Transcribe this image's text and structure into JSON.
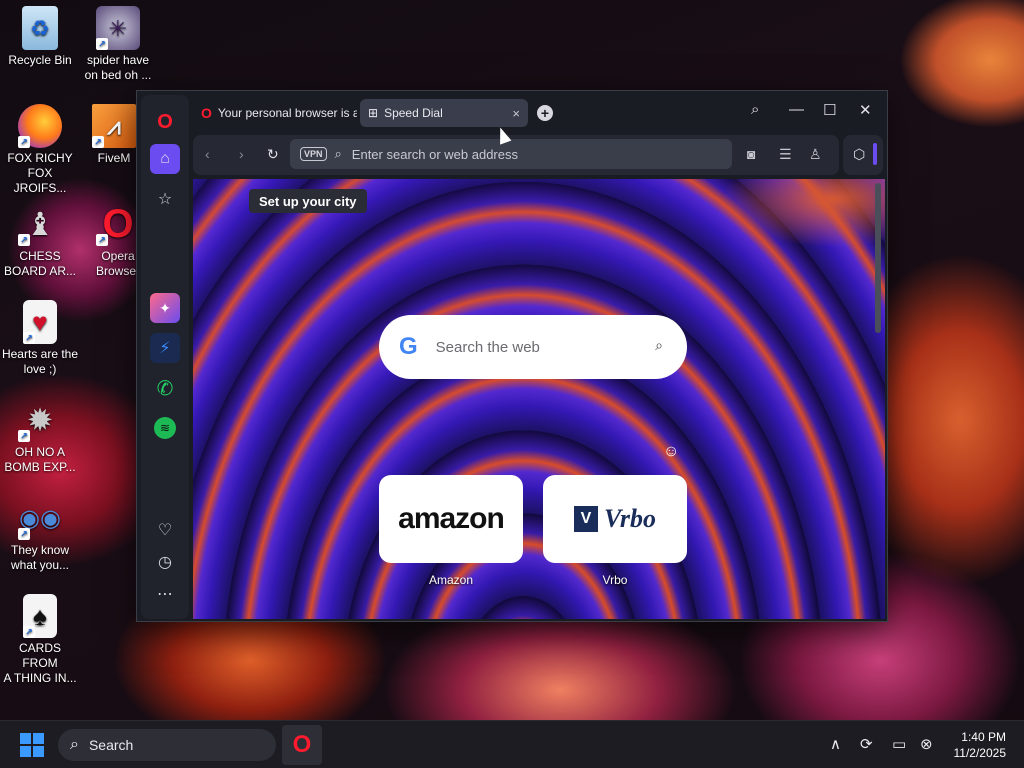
{
  "desktop": {
    "icons": [
      {
        "label_1": "Recycle Bin",
        "label_2": ""
      },
      {
        "label_1": "spider have",
        "label_2": "on bed oh ..."
      },
      {
        "label_1": "FOX RICHY",
        "label_2": "FOX JROIFS..."
      },
      {
        "label_1": "FiveM",
        "label_2": ""
      },
      {
        "label_1": "CHESS",
        "label_2": "BOARD AR..."
      },
      {
        "label_1": "Opera",
        "label_2": "Browser"
      },
      {
        "label_1": "Hearts are the",
        "label_2": "love ;)"
      },
      {
        "label_1": "OH NO A",
        "label_2": "BOMB EXP..."
      },
      {
        "label_1": "They know",
        "label_2": "what you..."
      },
      {
        "label_1": "CARDS FROM",
        "label_2": "A THING IN..."
      }
    ]
  },
  "browser": {
    "tabs": [
      {
        "label": "Your personal browser is a"
      },
      {
        "label": "Speed Dial",
        "close": "×"
      }
    ],
    "new_tab": "+",
    "address": {
      "vpn_label": "VPN",
      "placeholder": "Enter search or web address"
    },
    "city_tip": "Set up your city",
    "web_search": {
      "logo": "G",
      "placeholder": "Search the web"
    },
    "speed_dial": [
      {
        "label": "Amazon",
        "logo_text": "amazon"
      },
      {
        "label": "Vrbo",
        "logo_text": "Vrbo"
      }
    ]
  },
  "taskbar": {
    "search_label": "Search",
    "time": "1:40 PM",
    "date": "11/2/2025"
  },
  "colors": {
    "accent": "#6a4cf0",
    "opera_red": "#ff1b2d"
  }
}
